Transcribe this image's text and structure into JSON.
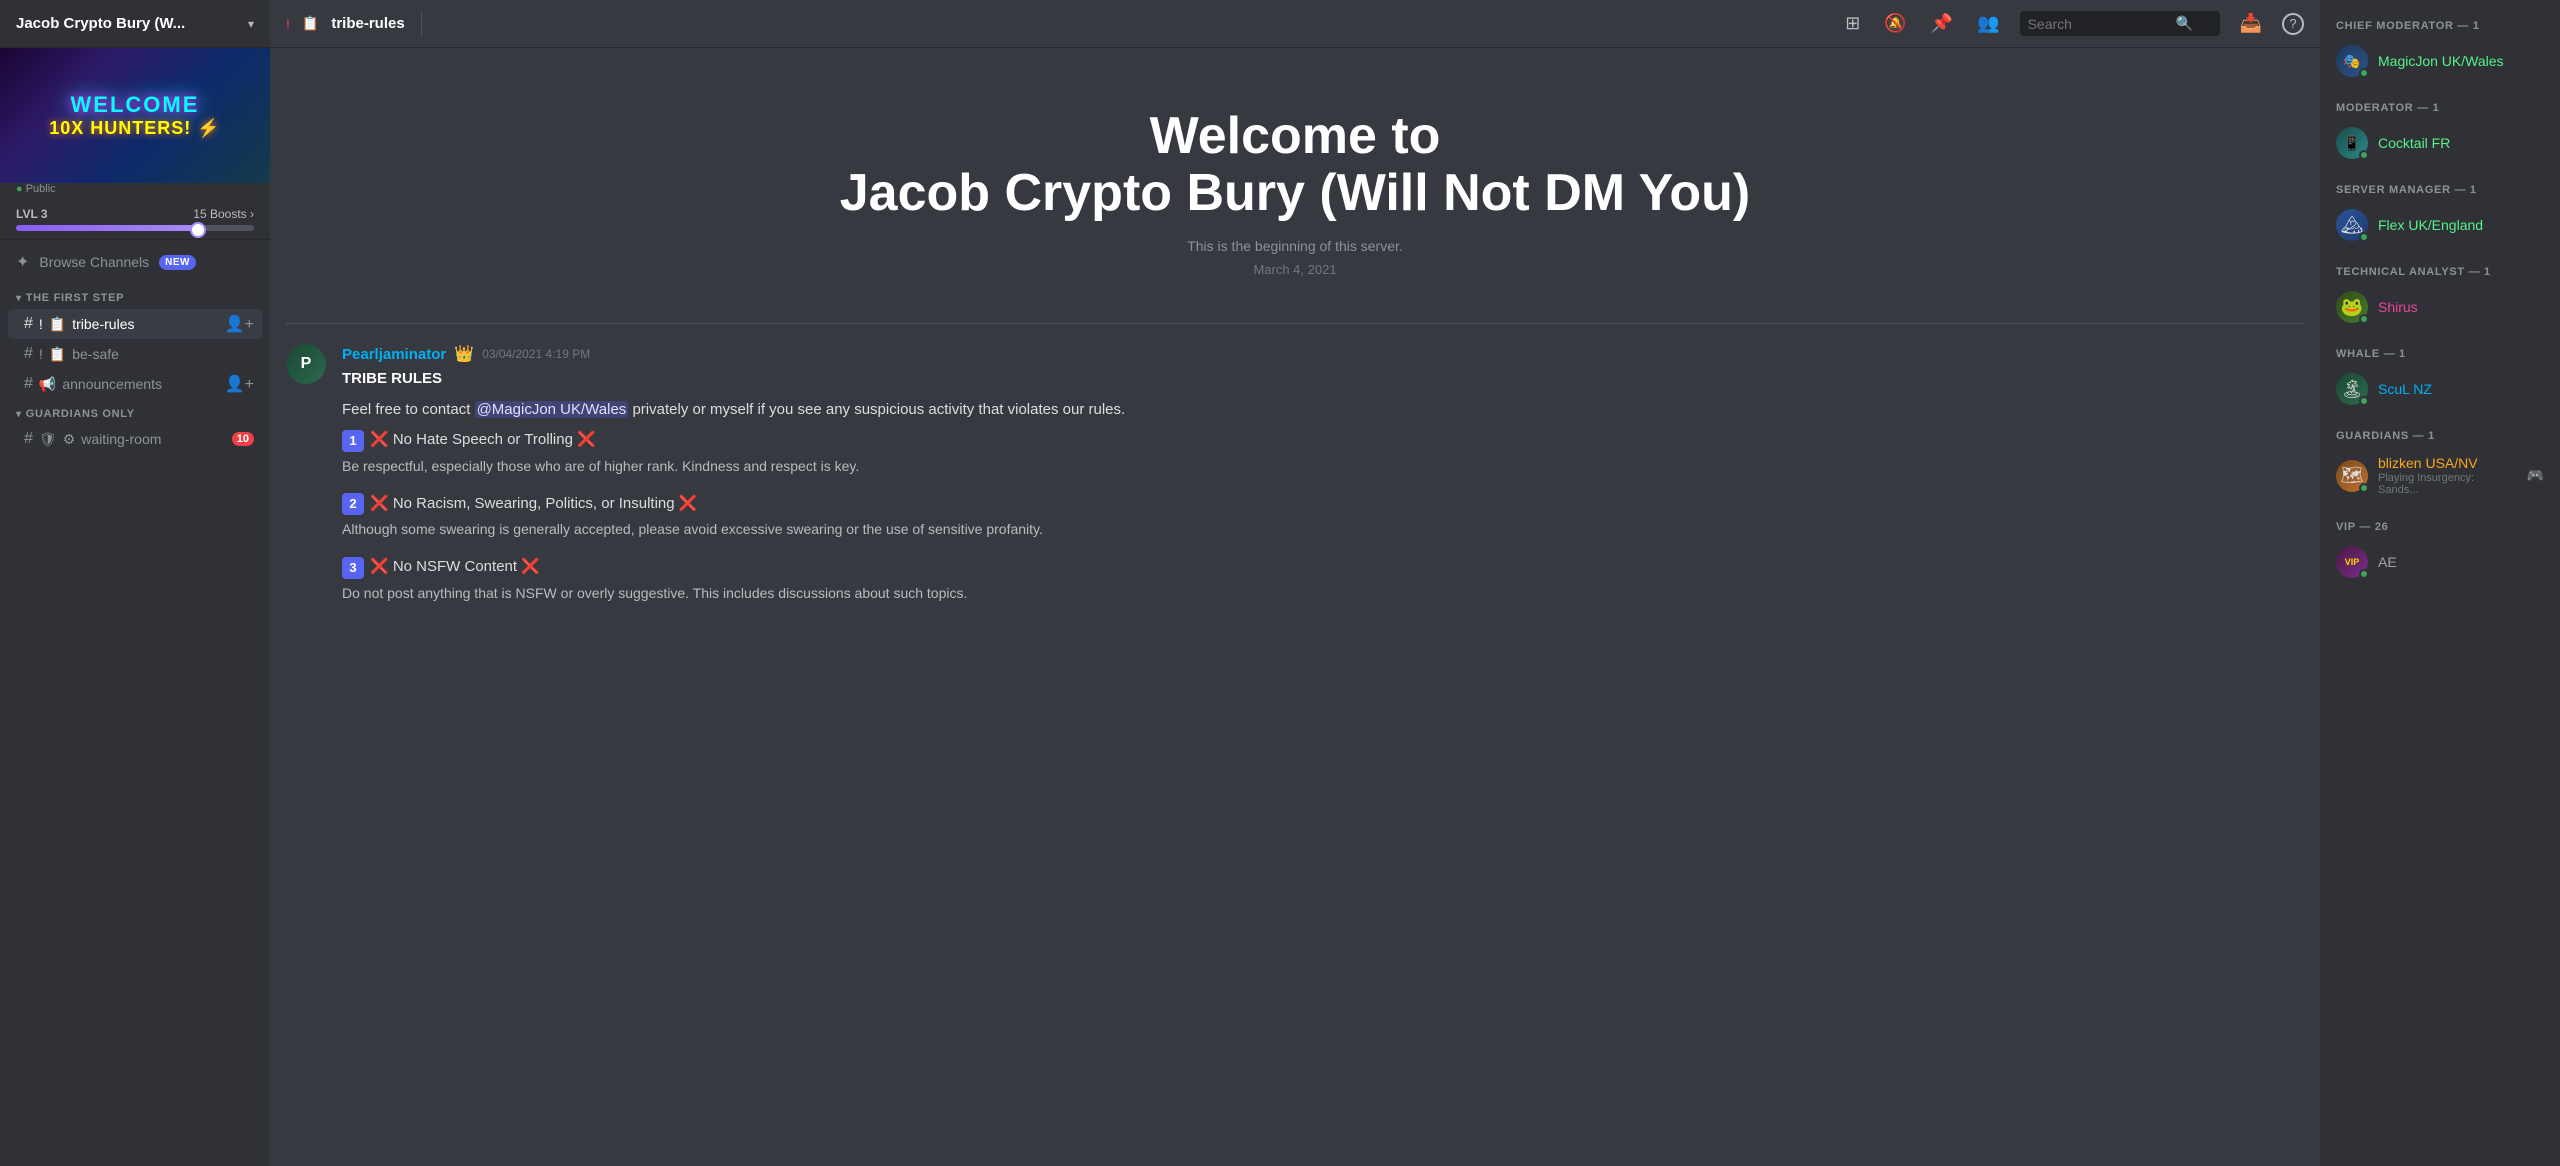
{
  "server": {
    "name": "Jacob Crypto Bury (W...",
    "full_name": "Jacob Crypto Bury (Will Not DM You)",
    "public": "Public",
    "level": "LVL 3",
    "boosts": "15 Boosts",
    "progress_percent": 78,
    "banner_welcome": "WELCOME",
    "banner_sub": "10X HUNTERS!",
    "banner_bolt": "⚡"
  },
  "browse_channels": {
    "label": "Browse Channels",
    "badge": "NEW"
  },
  "channel_sections": [
    {
      "id": "first-step",
      "label": "THE FIRST STEP",
      "channels": [
        {
          "id": "tribe-rules",
          "prefix": "!",
          "emoji": "📋",
          "name": "tribe-rules",
          "active": true,
          "add_member": true
        },
        {
          "id": "be-safe",
          "prefix": "!",
          "emoji": "📋",
          "name": "be-safe",
          "active": false,
          "add_member": false
        },
        {
          "id": "announcements",
          "prefix": "",
          "emoji": "📢",
          "name": "announcements",
          "active": false,
          "add_member": true
        }
      ]
    },
    {
      "id": "guardians-only",
      "label": "GUARDIANS ONLY",
      "channels": [
        {
          "id": "waiting-room",
          "prefix": "🛡",
          "emoji": "⚙",
          "name": "waiting-room",
          "active": false,
          "notification": 10
        }
      ]
    }
  ],
  "channel_header": {
    "icon": "!",
    "emoji": "📋",
    "name": "tribe-rules"
  },
  "header_icons": {
    "hashtag": "#",
    "bell_off": "🔕",
    "pin": "📌",
    "person": "👤",
    "search": "Search",
    "search_placeholder": "Search",
    "inbox": "📥",
    "help": "?"
  },
  "welcome": {
    "line1": "Welcome to",
    "server_name": "Jacob Crypto Bury (Will Not DM You)",
    "subtitle": "This is the beginning of this server.",
    "date": "March 4, 2021"
  },
  "messages": [
    {
      "id": "msg1",
      "author": "Pearljaminator",
      "author_badge": "👑",
      "timestamp": "03/04/2021 4:19 PM",
      "heading": "TRIBE RULES",
      "intro": "Feel free to contact @MagicJon UK/Wales privately or myself if you see any suspicious activity that violates our rules.",
      "rules": [
        {
          "num": "1",
          "title": "❌ No Hate Speech or Trolling ❌",
          "desc": "Be respectful, especially those who are of higher rank. Kindness and respect is key."
        },
        {
          "num": "2",
          "title": "❌ No Racism, Swearing, Politics, or Insulting ❌",
          "desc": "Although some swearing is generally accepted, please avoid excessive swearing or the use of sensitive profanity."
        },
        {
          "num": "3",
          "title": "❌ No NSFW Content ❌",
          "desc": "Do not post anything that is NSFW or overly suggestive. This includes discussions about such topics."
        }
      ]
    }
  ],
  "members": [
    {
      "category": "CHIEF MODERATOR — 1",
      "members": [
        {
          "name": "MagicJon UK/Wales",
          "role": "chief-mod",
          "avatar_type": "av-blue",
          "status": "online",
          "emoji": "🎭"
        }
      ]
    },
    {
      "category": "MODERATOR — 1",
      "members": [
        {
          "name": "Cocktail FR",
          "role": "moderator",
          "avatar_type": "av-teal",
          "status": "online",
          "emoji": "📱"
        }
      ]
    },
    {
      "category": "SERVER MANAGER — 1",
      "members": [
        {
          "name": "Flex UK/England",
          "role": "server-mgr",
          "avatar_type": "av-blue",
          "status": "online",
          "emoji": ""
        }
      ]
    },
    {
      "category": "TECHNICAL ANALYST — 1",
      "members": [
        {
          "name": "Shirus",
          "role": "analyst",
          "avatar_type": "av-frog",
          "status": "online",
          "emoji": ""
        }
      ]
    },
    {
      "category": "WHALE — 1",
      "members": [
        {
          "name": "ScuL NZ",
          "role": "whale",
          "avatar_type": "av-green",
          "status": "online",
          "emoji": ""
        }
      ]
    },
    {
      "category": "GUARDIANS — 1",
      "members": [
        {
          "name": "blizken USA/NV",
          "role": "guardian",
          "avatar_type": "av-orange",
          "status": "online",
          "emoji": "",
          "status_text": "Playing Insurgency: Sands...",
          "has_game_icon": true
        }
      ]
    },
    {
      "category": "VIP — 26",
      "members": [
        {
          "name": "AE",
          "role": "vip",
          "avatar_type": "av-purple",
          "status": "online",
          "emoji": "VIP"
        }
      ]
    }
  ]
}
